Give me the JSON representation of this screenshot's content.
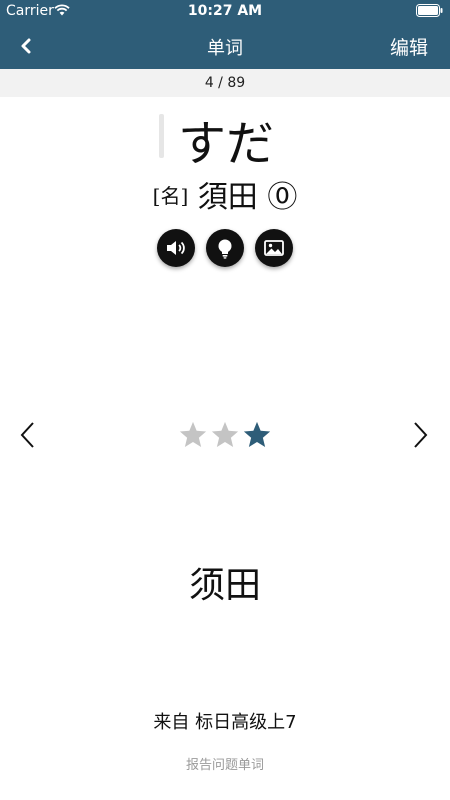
{
  "status_bar": {
    "carrier": "Carrier",
    "time": "10:27 AM"
  },
  "nav": {
    "title": "单词",
    "edit_label": "编辑",
    "back_icon": "chevron-left-icon"
  },
  "progress": {
    "text": "4 / 89"
  },
  "word": {
    "kana": "すだ",
    "pos": "[名]",
    "kanji": "須田",
    "accent": "⓪"
  },
  "actions": [
    {
      "icon": "speaker-icon"
    },
    {
      "icon": "lightbulb-icon"
    },
    {
      "icon": "image-icon"
    }
  ],
  "rating": {
    "filled": 1,
    "max": 3,
    "filled_color": "#2e5d78",
    "empty_color": "#c4c4c4"
  },
  "meaning": "须田",
  "source": "来自 标日高级上7",
  "report_label": "报告问题单词",
  "colors": {
    "header": "#2e5d78"
  }
}
